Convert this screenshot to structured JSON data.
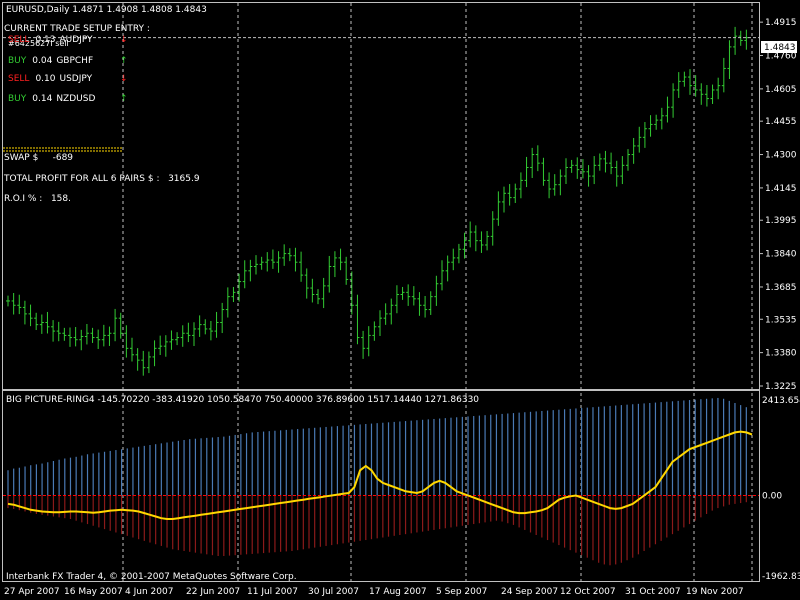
{
  "window": {
    "header": "EURUSD,Daily  1.4871 1.4908 1.4808 1.4843",
    "footer": "Interbank FX Trader 4, © 2001-2007 MetaQuotes Software Corp."
  },
  "panel": {
    "setup_title": "CURRENT TRADE SETUP ENTRY :",
    "overlap_text": "#6425627I sell",
    "trades": [
      {
        "side": "SELL",
        "lot": "0.13",
        "pair": "AUDJPY",
        "dir": "down"
      },
      {
        "side": "BUY",
        "lot": "0.04",
        "pair": "GBPCHF",
        "dir": "up"
      },
      {
        "side": "SELL",
        "lot": "0.10",
        "pair": "USDJPY",
        "dir": "down"
      },
      {
        "side": "BUY",
        "lot": "0.14",
        "pair": "NZDUSD",
        "dir": "up"
      }
    ],
    "swap_label": "SWAP $",
    "swap_value": "-689",
    "profit_label": "TOTAL PROFIT FOR ALL 6 PAIRS $ :",
    "profit_value": "3165.9",
    "roi_label": "R.O.I % :",
    "roi_value": "158."
  },
  "colors": {
    "candle": "#33cc33",
    "grid": "#c0c0c0",
    "bid_line": "#c0c0c0",
    "hist_up": "#4a7ab5",
    "hist_down": "#8b1a1a",
    "indicator_line": "#ffd700",
    "zero_line": "#ff0000"
  },
  "chart_data": [
    {
      "type": "line",
      "symbol": "EURUSD",
      "timeframe": "Daily",
      "ohlc_last": {
        "open": 1.4871,
        "high": 1.4908,
        "low": 1.4808,
        "close": 1.4843
      },
      "current_price_label": "1.4843",
      "y_ticks": [
        "1.4915",
        "1.4760",
        "1.4605",
        "1.4455",
        "1.4300",
        "1.4145",
        "1.3995",
        "1.3840",
        "1.3685",
        "1.3535",
        "1.3380",
        "1.3225"
      ],
      "ylim": [
        1.3225,
        1.499
      ],
      "x_ticks": [
        "27 Apr 2007",
        "16 May 2007",
        "4 Jun 2007",
        "22 Jun 2007",
        "11 Jul 2007",
        "30 Jul 2007",
        "17 Aug 2007",
        "5 Sep 2007",
        "24 Sep 2007",
        "12 Oct 2007",
        "31 Oct 2007",
        "19 Nov 2007"
      ],
      "closes": [
        1.362,
        1.36,
        1.359,
        1.356,
        1.354,
        1.351,
        1.352,
        1.35,
        1.348,
        1.347,
        1.346,
        1.345,
        1.344,
        1.3455,
        1.347,
        1.345,
        1.344,
        1.346,
        1.347,
        1.354,
        1.347,
        1.34,
        1.337,
        1.3345,
        1.331,
        1.336,
        1.34,
        1.341,
        1.343,
        1.344,
        1.345,
        1.347,
        1.346,
        1.349,
        1.351,
        1.349,
        1.348,
        1.352,
        1.358,
        1.364,
        1.366,
        1.371,
        1.376,
        1.378,
        1.379,
        1.38,
        1.381,
        1.38,
        1.382,
        1.384,
        1.383,
        1.38,
        1.374,
        1.368,
        1.365,
        1.363,
        1.369,
        1.378,
        1.382,
        1.38,
        1.372,
        1.36,
        1.345,
        1.34,
        1.346,
        1.35,
        1.354,
        1.356,
        1.36,
        1.365,
        1.366,
        1.364,
        1.363,
        1.36,
        1.358,
        1.364,
        1.37,
        1.376,
        1.38,
        1.382,
        1.386,
        1.39,
        1.394,
        1.39,
        1.388,
        1.392,
        1.4,
        1.408,
        1.412,
        1.41,
        1.414,
        1.418,
        1.424,
        1.43,
        1.426,
        1.418,
        1.414,
        1.416,
        1.42,
        1.424,
        1.425,
        1.423,
        1.422,
        1.42,
        1.425,
        1.428,
        1.426,
        1.424,
        1.42,
        1.425,
        1.43,
        1.434,
        1.438,
        1.442,
        1.444,
        1.446,
        1.448,
        1.452,
        1.46,
        1.464,
        1.466,
        1.462,
        1.46,
        1.458,
        1.456,
        1.46,
        1.462,
        1.47,
        1.48,
        1.485,
        1.483,
        1.4843
      ],
      "title": "",
      "xlabel": "",
      "ylabel": "",
      "grid": true
    },
    {
      "type": "bar",
      "name": "BIG PICTURE-RING4",
      "label": "BIG PICTURE-RING4 -145.70220 -383.41920 1050.58470 750.40000 376.89600 1517.14440 1271.86330",
      "y_ticks": [
        "2413.654",
        "0.00",
        "-1962.83"
      ],
      "ylim": [
        -1962.83,
        2413.654
      ],
      "series": [
        {
          "name": "up",
          "values": [
            600,
            640,
            660,
            690,
            720,
            740,
            760,
            790,
            820,
            850,
            880,
            900,
            920,
            950,
            980,
            1000,
            1020,
            1040,
            1060,
            1080,
            1100,
            1120,
            1140,
            1160,
            1180,
            1200,
            1220,
            1240,
            1260,
            1280,
            1300,
            1320,
            1340,
            1350,
            1360,
            1370,
            1380,
            1390,
            1400,
            1420,
            1440,
            1460,
            1480,
            1500,
            1510,
            1520,
            1530,
            1540,
            1550,
            1560,
            1570,
            1580,
            1590,
            1600,
            1610,
            1620,
            1630,
            1640,
            1650,
            1660,
            1670,
            1680,
            1690,
            1700,
            1710,
            1720,
            1730,
            1740,
            1750,
            1760,
            1770,
            1780,
            1790,
            1800,
            1810,
            1820,
            1830,
            1840,
            1850,
            1860,
            1870,
            1880,
            1890,
            1900,
            1910,
            1920,
            1930,
            1940,
            1950,
            1960,
            1970,
            1980,
            1990,
            2000,
            2010,
            2020,
            2030,
            2040,
            2050,
            2060,
            2070,
            2080,
            2090,
            2100,
            2110,
            2120,
            2130,
            2140,
            2150,
            2160,
            2170,
            2180,
            2190,
            2200,
            2210,
            2220,
            2230,
            2240,
            2250,
            2260,
            2270,
            2280,
            2290,
            2300,
            2310,
            2320,
            2300,
            2250,
            2200,
            2150,
            2100
          ]
        },
        {
          "name": "down",
          "values": [
            -300,
            -320,
            -350,
            -380,
            -410,
            -440,
            -460,
            -480,
            -500,
            -520,
            -540,
            -560,
            -600,
            -640,
            -680,
            -720,
            -760,
            -800,
            -840,
            -880,
            -920,
            -960,
            -1000,
            -1040,
            -1080,
            -1120,
            -1160,
            -1200,
            -1240,
            -1280,
            -1300,
            -1320,
            -1340,
            -1360,
            -1380,
            -1400,
            -1420,
            -1440,
            -1440,
            -1430,
            -1420,
            -1410,
            -1400,
            -1390,
            -1380,
            -1370,
            -1360,
            -1350,
            -1340,
            -1330,
            -1320,
            -1300,
            -1280,
            -1260,
            -1240,
            -1220,
            -1200,
            -1180,
            -1160,
            -1140,
            -1120,
            -1100,
            -1080,
            -1060,
            -1040,
            -1020,
            -1000,
            -980,
            -960,
            -940,
            -920,
            -900,
            -880,
            -860,
            -840,
            -820,
            -800,
            -780,
            -760,
            -740,
            -720,
            -700,
            -680,
            -660,
            -640,
            -620,
            -600,
            -620,
            -660,
            -700,
            -760,
            -820,
            -880,
            -940,
            -1000,
            -1060,
            -1120,
            -1180,
            -1240,
            -1300,
            -1360,
            -1420,
            -1480,
            -1540,
            -1600,
            -1640,
            -1660,
            -1640,
            -1600,
            -1540,
            -1480,
            -1400,
            -1320,
            -1240,
            -1160,
            -1080,
            -1000,
            -920,
            -840,
            -760,
            -680,
            -600,
            -520,
            -440,
            -360,
            -300,
            -260,
            -220,
            -200,
            -180,
            -160,
            -150,
            -140,
            -130,
            -120
          ]
        },
        {
          "name": "line",
          "values": [
            -200,
            -220,
            -260,
            -300,
            -340,
            -360,
            -380,
            -390,
            -400,
            -400,
            -390,
            -380,
            -380,
            -390,
            -400,
            -410,
            -400,
            -380,
            -360,
            -350,
            -340,
            -350,
            -360,
            -380,
            -420,
            -460,
            -500,
            -540,
            -560,
            -560,
            -540,
            -520,
            -500,
            -480,
            -460,
            -440,
            -420,
            -400,
            -380,
            -360,
            -340,
            -320,
            -300,
            -280,
            -260,
            -240,
            -220,
            -200,
            -180,
            -160,
            -140,
            -120,
            -100,
            -80,
            -60,
            -40,
            -20,
            0,
            20,
            40,
            60,
            200,
            600,
            700,
            600,
            400,
            300,
            250,
            200,
            150,
            100,
            80,
            60,
            100,
            200,
            300,
            350,
            300,
            200,
            100,
            50,
            0,
            -50,
            -100,
            -150,
            -200,
            -250,
            -300,
            -350,
            -400,
            -420,
            -420,
            -400,
            -380,
            -350,
            -300,
            -200,
            -100,
            -50,
            -20,
            0,
            -50,
            -100,
            -150,
            -200,
            -250,
            -300,
            -320,
            -300,
            -250,
            -200,
            -100,
            0,
            100,
            200,
            400,
            600,
            800,
            900,
            1000,
            1100,
            1150,
            1200,
            1250,
            1300,
            1350,
            1400,
            1450,
            1500,
            1520,
            1500,
            1450
          ]
        }
      ],
      "title": "",
      "xlabel": "",
      "ylabel": "",
      "grid": true
    }
  ]
}
